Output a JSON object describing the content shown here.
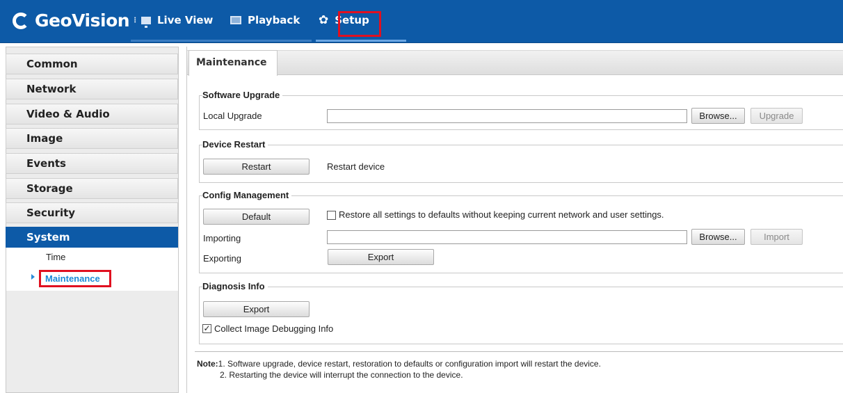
{
  "app": {
    "brand": "GeoVision",
    "nav": [
      {
        "label": "Live View",
        "icon": "monitor-icon"
      },
      {
        "label": "Playback",
        "icon": "playback-icon"
      },
      {
        "label": "Setup",
        "icon": "gear-icon"
      }
    ],
    "colors": {
      "header": "#0d5aa7",
      "highlight": "#e01020",
      "active_link": "#1a8ad8"
    }
  },
  "sidebar": {
    "items": [
      "Common",
      "Network",
      "Video & Audio",
      "Image",
      "Events",
      "Storage",
      "Security",
      "System"
    ],
    "active": "System",
    "sub_items": [
      "Time",
      "Maintenance"
    ],
    "active_sub": "Maintenance"
  },
  "main": {
    "tab": "Maintenance",
    "software_upgrade": {
      "title": "Software Upgrade",
      "local_upgrade_label": "Local Upgrade",
      "browse_label": "Browse...",
      "upgrade_label": "Upgrade"
    },
    "device_restart": {
      "title": "Device Restart",
      "restart_label": "Restart",
      "restart_desc": "Restart device"
    },
    "config_management": {
      "title": "Config Management",
      "default_label": "Default",
      "restore_checkbox_label": "Restore all settings to defaults without keeping current network and user settings.",
      "restore_checked": false,
      "importing_label": "Importing",
      "browse_label": "Browse...",
      "import_label": "Import",
      "exporting_label": "Exporting",
      "export_label": "Export"
    },
    "diagnosis_info": {
      "title": "Diagnosis Info",
      "export_label": "Export",
      "collect_label": "Collect Image Debugging Info",
      "collect_checked": true
    },
    "note": {
      "prefix": "Note:",
      "line1": "1. Software upgrade, device restart, restoration to defaults or configuration import will restart the device.",
      "line2": "2. Restarting the device will interrupt the connection to the device."
    }
  }
}
